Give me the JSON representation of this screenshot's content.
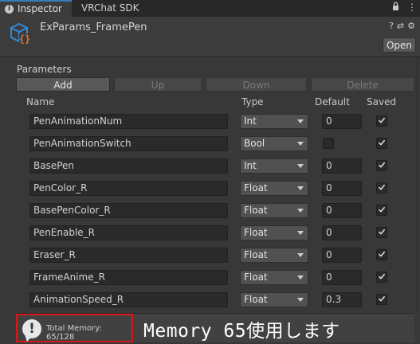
{
  "tabs": {
    "inspector": "Inspector",
    "vrchat_sdk": "VRChat SDK",
    "icons": [
      "lock-icon",
      "menu-icon"
    ]
  },
  "component": {
    "title": "ExParams_FramePen",
    "open_button": "Open",
    "icons": [
      "help-icon",
      "sliders-icon",
      "gear-icon"
    ]
  },
  "parameters": {
    "section_label": "Parameters",
    "buttons": {
      "add": "Add",
      "up": "Up",
      "down": "Down",
      "delete": "Delete"
    },
    "columns": {
      "name": "Name",
      "type": "Type",
      "default": "Default",
      "saved": "Saved"
    },
    "rows": [
      {
        "name": "PenAnimationNum",
        "type": "Int",
        "default": "0",
        "saved": true
      },
      {
        "name": "PenAnimationSwitch",
        "type": "Bool",
        "default": "",
        "saved": true
      },
      {
        "name": "BasePen",
        "type": "Int",
        "default": "0",
        "saved": true
      },
      {
        "name": "PenColor_R",
        "type": "Float",
        "default": "0",
        "saved": true
      },
      {
        "name": "BasePenColor_R",
        "type": "Float",
        "default": "0",
        "saved": true
      },
      {
        "name": "PenEnable_R",
        "type": "Float",
        "default": "0",
        "saved": true
      },
      {
        "name": "Eraser_R",
        "type": "Float",
        "default": "0",
        "saved": true
      },
      {
        "name": "FrameAnime_R",
        "type": "Float",
        "default": "0",
        "saved": true
      },
      {
        "name": "AnimationSpeed_R",
        "type": "Float",
        "default": "0.3",
        "saved": true
      }
    ]
  },
  "memory": {
    "text": "Total Memory: 65/128",
    "annotation": "Memory 65使用します"
  },
  "colors": {
    "accent_tab": "#3a79bb",
    "highlight_box": "#d81818",
    "cube_icon": "#2f8ad8",
    "braces": "#e4702f"
  }
}
